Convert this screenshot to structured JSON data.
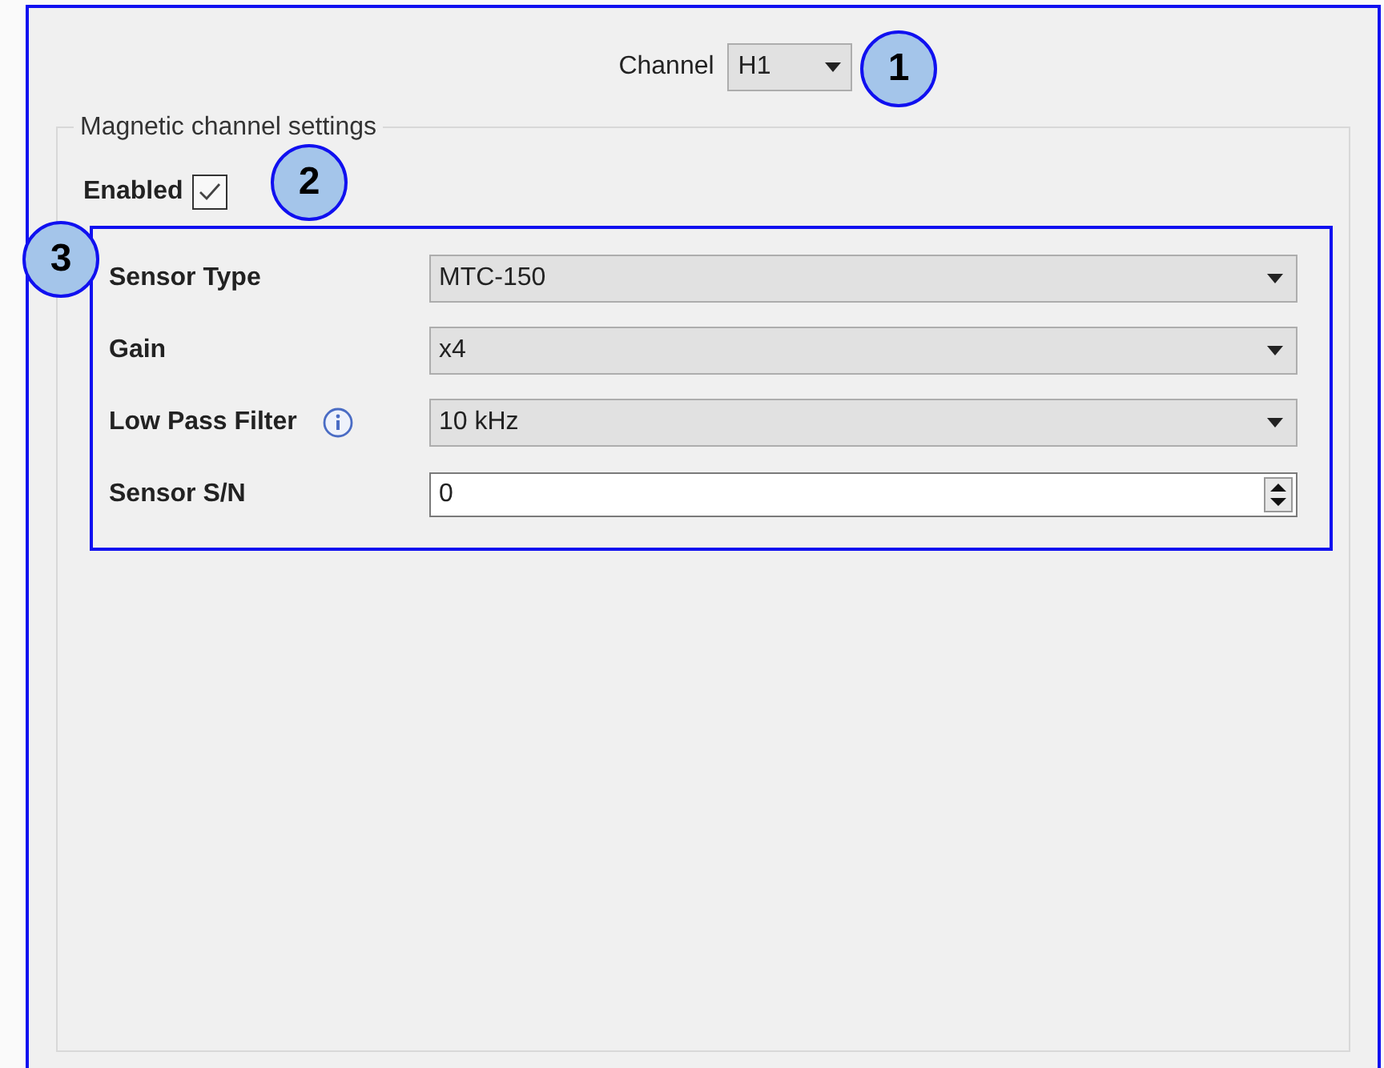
{
  "channel": {
    "label": "Channel",
    "value": "H1"
  },
  "group": {
    "title": "Magnetic channel settings",
    "enabled": {
      "label": "Enabled",
      "checked": true
    },
    "fields": [
      {
        "kind": "dropdown",
        "label": "Sensor Type",
        "value": "MTC-150",
        "info": false
      },
      {
        "kind": "dropdown",
        "label": "Gain",
        "value": "x4",
        "info": false
      },
      {
        "kind": "dropdown",
        "label": "Low Pass Filter",
        "value": "10 kHz",
        "info": true
      },
      {
        "kind": "spinbox",
        "label": "Sensor S/N",
        "value": "0",
        "info": false
      }
    ]
  },
  "callouts": [
    "1",
    "2",
    "3"
  ]
}
